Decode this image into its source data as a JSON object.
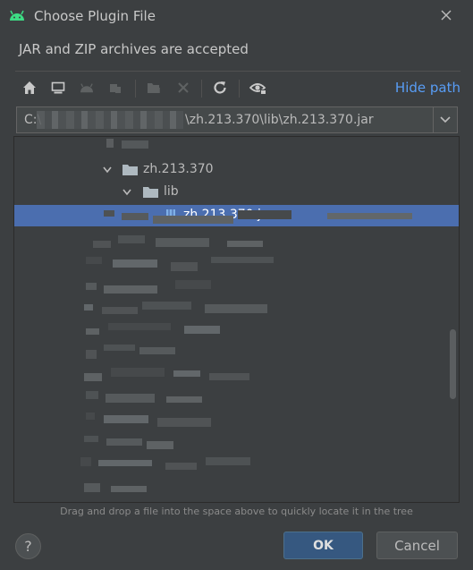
{
  "window": {
    "title": "Choose Plugin File",
    "subtitle": "JAR and ZIP archives are accepted"
  },
  "toolbar": {
    "buttons": [
      "home-icon",
      "desktop-icon",
      "android-icon",
      "module-icon",
      "new-folder-icon",
      "delete-icon",
      "refresh-icon",
      "show-hidden-icon"
    ],
    "hide_path_label": "Hide path"
  },
  "path": {
    "prefix": "C:\\",
    "suffix": "\\zh.213.370\\lib\\zh.213.370.jar"
  },
  "tree": {
    "folder_1": "zh.213.370",
    "folder_2": "lib",
    "selected_file": "zh.213.370.jar"
  },
  "hint": "Drag and drop a file into the space above to quickly locate it in the tree",
  "footer": {
    "help_label": "?",
    "ok_label": "OK",
    "cancel_label": "Cancel"
  },
  "colors": {
    "background": "#3c3f41",
    "selection": "#4b6eaf",
    "link": "#589df6",
    "ok_button": "#365880"
  }
}
